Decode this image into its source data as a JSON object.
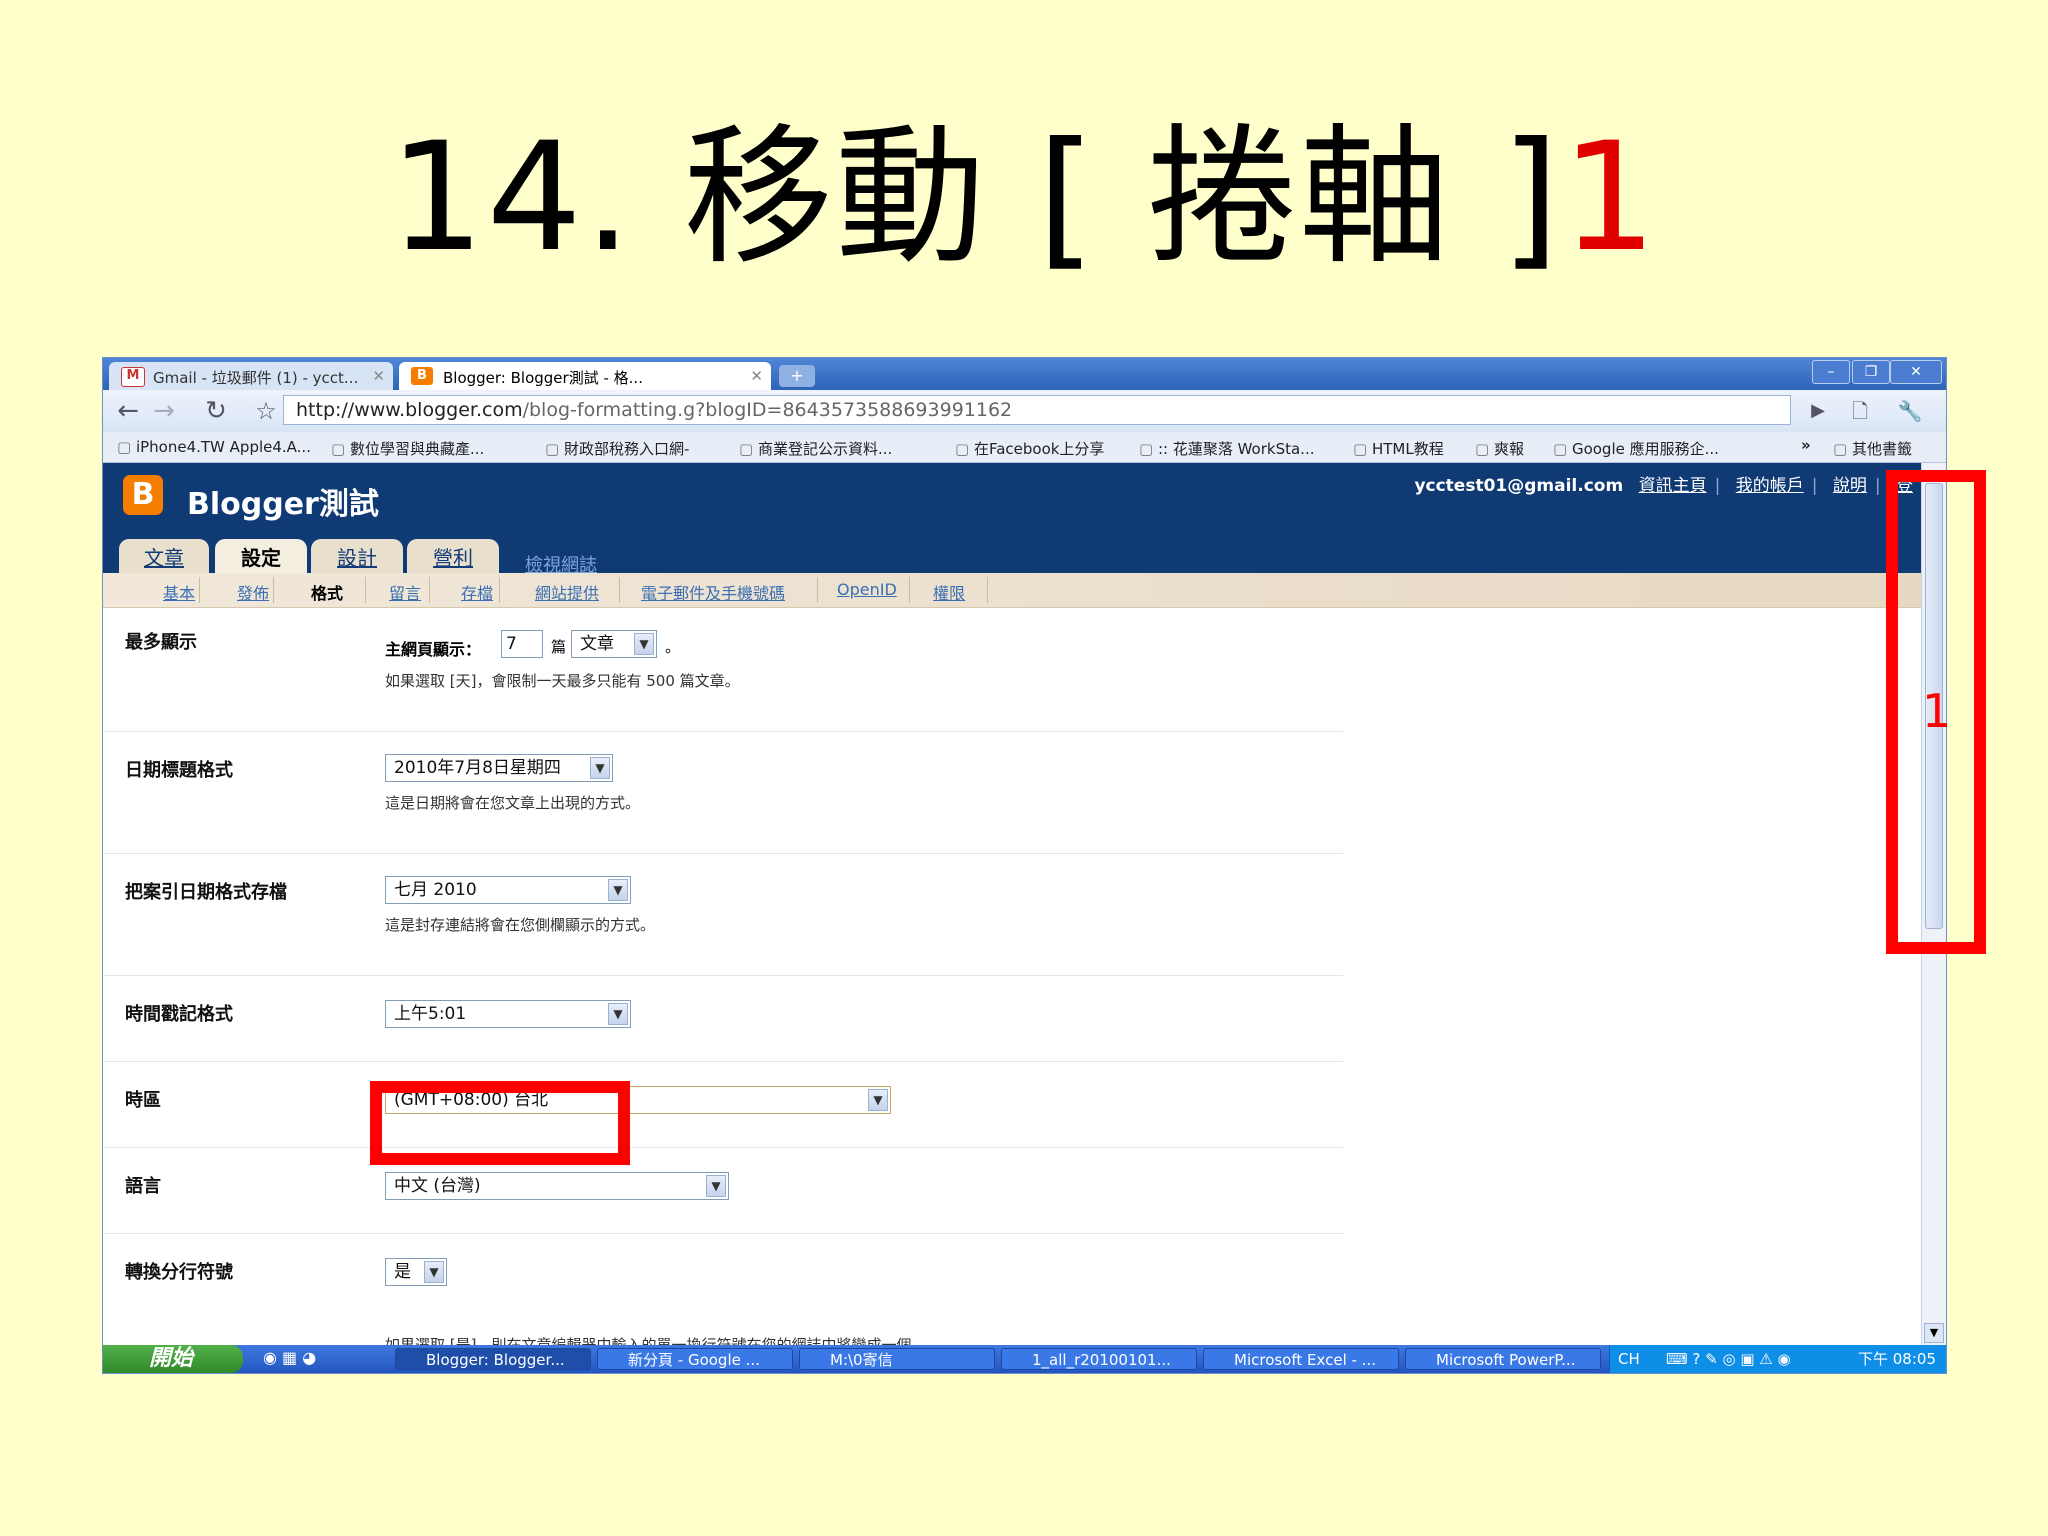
{
  "slide": {
    "title_main": "14. 移動 [ 捲軸 ]",
    "title_num": "1"
  },
  "browser": {
    "tabs": [
      {
        "label": "Gmail - 垃圾郵件 (1) - ycct..."
      },
      {
        "label": "Blogger: Blogger測試 - 格..."
      }
    ],
    "new_tab": "+",
    "url_host": "http://www.blogger.com",
    "url_path": "/blog-formatting.g?blogID=8643573588693991162",
    "bookmarks": [
      "iPhone4.TW Apple4.A...",
      "數位學習與典藏產...",
      "財政部稅務入口網-",
      "商業登記公示資料...",
      "在Facebook上分享",
      ":: 花蓮聚落 WorkSta...",
      "HTML教程",
      "爽報",
      "Google 應用服務企...",
      "»",
      "其他書籤"
    ]
  },
  "blogger": {
    "logo": "B",
    "blog_title": "Blogger測試",
    "account_email": "ycctest01@gmail.com",
    "account_links": [
      "資訊主頁",
      "我的帳戶",
      "說明",
      "登"
    ],
    "main_tabs": [
      "文章",
      "設定",
      "設計",
      "營利"
    ],
    "view_blog": "檢視網誌",
    "sub_tabs": [
      "基本",
      "發佈",
      "格式",
      "留言",
      "存檔",
      "網站提供",
      "電子郵件及手機號碼",
      "OpenID",
      "權限"
    ],
    "current_sub_tab": "格式"
  },
  "settings": {
    "max_display": {
      "label": "最多顯示",
      "prefix": "主網頁顯示：",
      "value": "7",
      "unit": "篇",
      "select": "文章",
      "suffix": "。",
      "help": "如果選取 [天]，會限制一天最多只能有 500 篇文章。"
    },
    "date_header": {
      "label": "日期標題格式",
      "select": "2010年7月8日星期四",
      "help": "這是日期將會在您文章上出現的方式。"
    },
    "archive_date": {
      "label": "把案引日期格式存檔",
      "select": "七月 2010",
      "help": "這是封存連結將會在您側欄顯示的方式。"
    },
    "timestamp": {
      "label": "時間戳記格式",
      "select": "上午5:01"
    },
    "timezone": {
      "label": "時區",
      "select": "(GMT+08:00) 台北"
    },
    "language": {
      "label": "語言",
      "select": "中文 (台灣)"
    },
    "line_breaks": {
      "label": "轉換分行符號",
      "select": "是",
      "help": "如果選取 [是]，則在文章編輯器中輸入的單一換行符號在您的網誌中將變成一個"
    }
  },
  "taskbar": {
    "start": "開始",
    "items": [
      "Blogger: Blogger...",
      "新分頁 - Google ...",
      "M:\\0寄信",
      "1_all_r20100101...",
      "Microsoft Excel - ...",
      "Microsoft PowerP..."
    ],
    "lang": "CH",
    "time": "下午 08:05"
  },
  "annotation": {
    "label": "1",
    "color": "#ff0000"
  }
}
